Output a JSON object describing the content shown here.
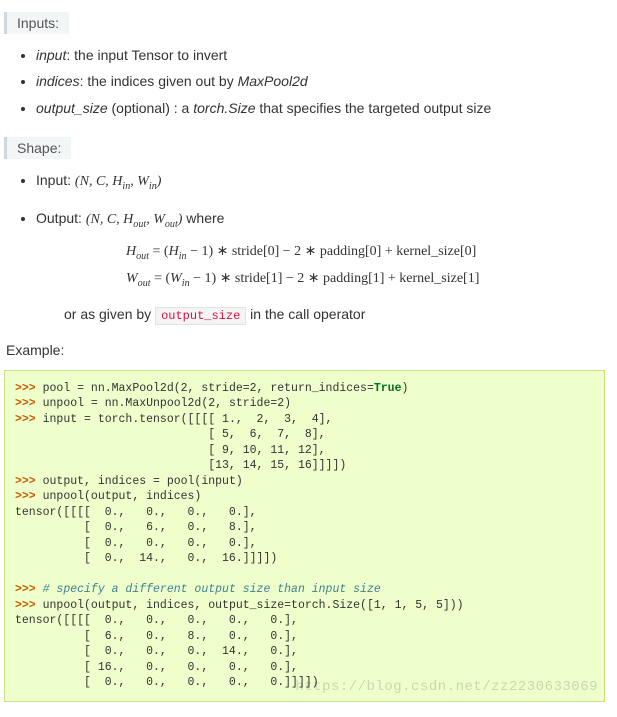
{
  "sections": {
    "inputs_label": "Inputs:",
    "shape_label": "Shape:",
    "example_label": "Example:"
  },
  "inputs": [
    {
      "name": "input",
      "desc": ": the input Tensor to invert"
    },
    {
      "name": "indices",
      "desc_prefix": ": the indices given out by ",
      "ref": "MaxPool2d"
    },
    {
      "name": "output_size",
      "opt": " (optional)",
      "desc_prefix": " : a ",
      "ref": "torch.Size",
      "desc_suffix": " that specifies the targeted output size"
    }
  ],
  "shape": {
    "input_label": "Input: ",
    "input_expr": "(N, C, H_in, W_in)",
    "output_label": "Output: ",
    "output_expr": "(N, C, H_out, W_out)",
    "output_suffix": " where",
    "formula1": "H_out = (H_in − 1) ∗ stride[0] − 2 ∗ padding[0] + kernel_size[0]",
    "formula2": "W_out = (W_in − 1) ∗ stride[1] − 2 ∗ padding[1] + kernel_size[1]",
    "or_text_a": "or as given by ",
    "output_size_code": "output_size",
    "or_text_b": " in the call operator"
  },
  "code": {
    "l01a": ">>> ",
    "l01b": "pool = nn.MaxPool2d(2, stride=2, return_indices=",
    "l01c": "True",
    "l01d": ")",
    "l02a": ">>> ",
    "l02b": "unpool = nn.MaxUnpool2d(2, stride=2)",
    "l03a": ">>> ",
    "l03b": "input = torch.tensor([[[[ 1.,  2,  3,  4],",
    "l04": "                            [ 5,  6,  7,  8],",
    "l05": "                            [ 9, 10, 11, 12],",
    "l06": "                            [13, 14, 15, 16]]]])",
    "l07a": ">>> ",
    "l07b": "output, indices = pool(input)",
    "l08a": ">>> ",
    "l08b": "unpool(output, indices)",
    "l09": "tensor([[[[  0.,   0.,   0.,   0.],",
    "l10": "          [  0.,   6.,   0.,   8.],",
    "l11": "          [  0.,   0.,   0.,   0.],",
    "l12": "          [  0.,  14.,   0.,  16.]]]])",
    "blank": "",
    "l13a": ">>> ",
    "l13b": "# specify a different output size than input size",
    "l14a": ">>> ",
    "l14b": "unpool(output, indices, output_size=torch.Size([1, 1, 5, 5]))",
    "l15": "tensor([[[[  0.,   0.,   0.,   0.,   0.],",
    "l16": "          [  6.,   0.,   8.,   0.,   0.],",
    "l17": "          [  0.,   0.,   0.,  14.,   0.],",
    "l18": "          [ 16.,   0.,   0.,   0.,   0.],",
    "l19": "          [  0.,   0.,   0.,   0.,   0.]]]])"
  },
  "watermark": "https://blog.csdn.net/zz2230633069"
}
